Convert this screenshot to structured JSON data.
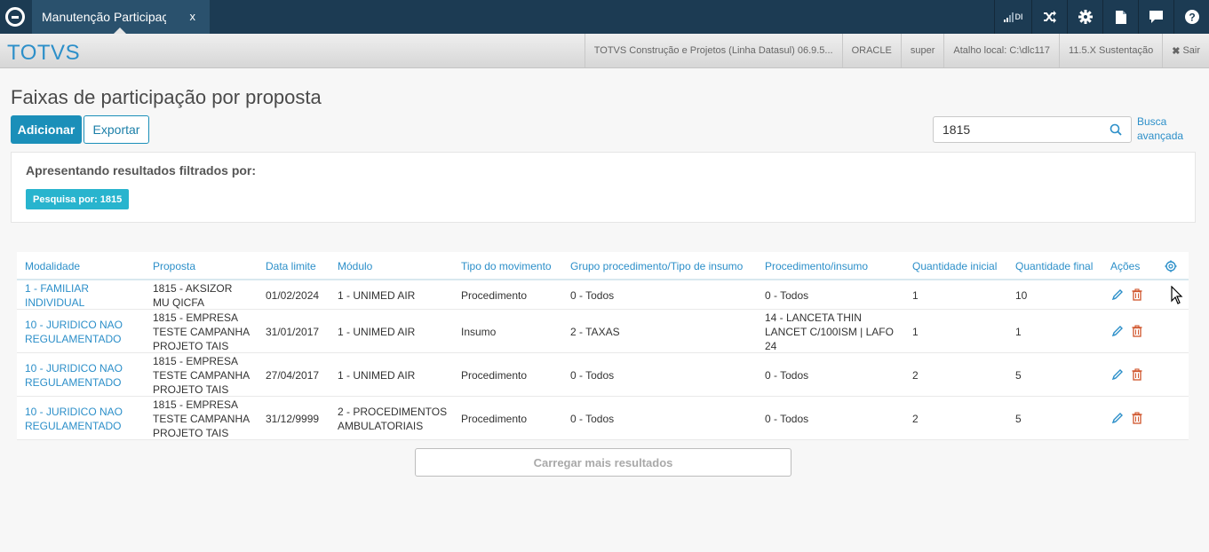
{
  "window": {
    "tab_label": "Manutenção Participaç",
    "tab_close": "x",
    "signal_label": "DI",
    "icons": [
      "signal-icon",
      "shuffle-icon",
      "gear-icon",
      "file-icon",
      "chat-icon",
      "help-icon"
    ]
  },
  "subbar": {
    "brand": "TOTVS",
    "items": [
      "TOTVS Construção e Projetos (Linha Datasul) 06.9.5...",
      "ORACLE",
      "super",
      "Atalho local: C:\\dlc117",
      "11.5.X Sustentação"
    ],
    "logout_label": "Sair"
  },
  "page": {
    "title": "Faixas de participação por proposta",
    "add_label": "Adicionar",
    "export_label": "Exportar",
    "search_value": "1815",
    "advanced_search_label": "Busca avançada",
    "filter_title": "Apresentando resultados filtrados por:",
    "filter_chip": "Pesquisa por: 1815",
    "load_more_label": "Carregar mais resultados"
  },
  "table": {
    "headers": [
      "Modalidade",
      "Proposta",
      "Data limite",
      "Módulo",
      "Tipo do movimento",
      "Grupo procedimento/Tipo de insumo",
      "Procedimento/insumo",
      "Quantidade inicial",
      "Quantidade final",
      "Ações"
    ],
    "rows": [
      {
        "modalidade": [
          "1 - FAMILIAR",
          "INDIVIDUAL"
        ],
        "proposta": [
          "1815 - AKSIZOR",
          "MU QICFA"
        ],
        "data_limite": "01/02/2024",
        "modulo": [
          "1 - UNIMED AIR"
        ],
        "tipo_movimento": "Procedimento",
        "grupo": "0 - Todos",
        "procedimento": [
          "0 - Todos"
        ],
        "qtd_inicial": "1",
        "qtd_final": "10"
      },
      {
        "modalidade": [
          "10 - JURIDICO NAO",
          "REGULAMENTADO"
        ],
        "proposta": [
          "1815 - EMPRESA",
          "TESTE CAMPANHA",
          "PROJETO TAIS"
        ],
        "data_limite": "31/01/2017",
        "modulo": [
          "1 - UNIMED AIR"
        ],
        "tipo_movimento": "Insumo",
        "grupo": "2 - TAXAS",
        "procedimento": [
          "14 - LANCETA THIN",
          "LANCET C/100ISM | LAFO",
          "24"
        ],
        "qtd_inicial": "1",
        "qtd_final": "1"
      },
      {
        "modalidade": [
          "10 - JURIDICO NAO",
          "REGULAMENTADO"
        ],
        "proposta": [
          "1815 - EMPRESA",
          "TESTE CAMPANHA",
          "PROJETO TAIS"
        ],
        "data_limite": "27/04/2017",
        "modulo": [
          "1 - UNIMED AIR"
        ],
        "tipo_movimento": "Procedimento",
        "grupo": "0 - Todos",
        "procedimento": [
          "0 - Todos"
        ],
        "qtd_inicial": "2",
        "qtd_final": "5"
      },
      {
        "modalidade": [
          "10 - JURIDICO NAO",
          "REGULAMENTADO"
        ],
        "proposta": [
          "1815 - EMPRESA",
          "TESTE CAMPANHA",
          "PROJETO TAIS"
        ],
        "data_limite": "31/12/9999",
        "modulo": [
          "2 - PROCEDIMENTOS",
          "AMBULATORIAIS"
        ],
        "tipo_movimento": "Procedimento",
        "grupo": "0 - Todos",
        "procedimento": [
          "0 - Todos"
        ],
        "qtd_inicial": "2",
        "qtd_final": "5"
      }
    ]
  },
  "colors": {
    "topbar": "#1c3b53",
    "accent": "#1b8fb9",
    "link": "#2c8fc9",
    "chip": "#28b4ce",
    "delete": "#d0542b"
  }
}
